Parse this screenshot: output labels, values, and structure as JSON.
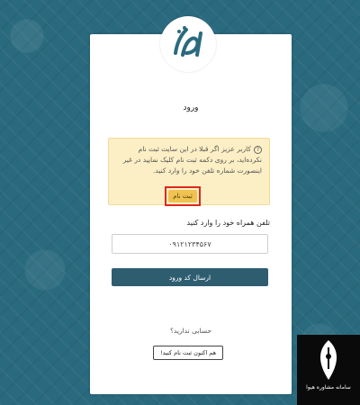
{
  "logo": {
    "icon": "alefba-logo-icon"
  },
  "login": {
    "title": "ورود",
    "notice": "کاربر عزیز اگر قبلا در این سایت ثبت نام نکرده‌اید، بر روی دکمه ثبت نام کلیک نمایید در غیر اینصورت شماره تلفن خود را وارد کنید.",
    "signup_button": "ثبت نام",
    "phone_label": "تلفن همراه خود را وارد کنید",
    "phone_value": "۰۹۱۲۱۲۳۴۵۶۷",
    "send_code_button": "ارسال کد ورود",
    "no_account": "حسابی ندارید؟",
    "register_now_button": "هم اکنون ثبت نام کنید!"
  },
  "watermark": {
    "text": "سامانه مشاوره هیوا"
  },
  "colors": {
    "background": "#2a6a7e",
    "primary_button": "#2e5d70",
    "notice_bg": "#fcefc5",
    "signup_bg": "#f0c250",
    "highlight_border": "#e0271f"
  }
}
